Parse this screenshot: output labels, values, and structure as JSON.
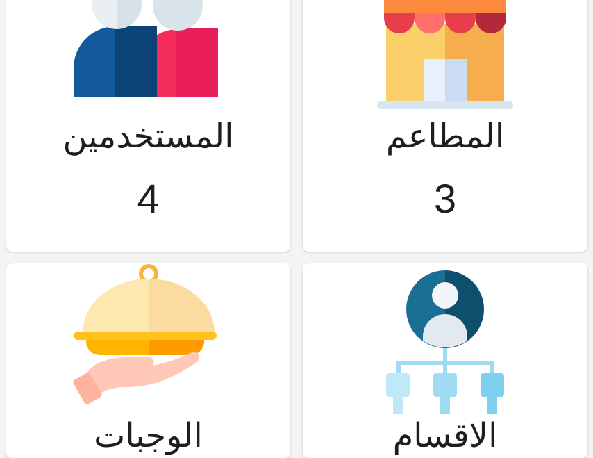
{
  "cards": [
    {
      "title": "المطاعم",
      "count": "3",
      "icon": "restaurant-storefront-icon"
    },
    {
      "title": "المستخدمين",
      "count": "4",
      "icon": "users-group-icon"
    },
    {
      "title": "الاقسام",
      "icon": "categories-hierarchy-icon"
    },
    {
      "title": "الوجبات",
      "icon": "meal-cloche-serving-icon"
    }
  ],
  "colors": {
    "background": "#f4f4f4",
    "card": "#ffffff",
    "text": "#1e1e1e"
  }
}
